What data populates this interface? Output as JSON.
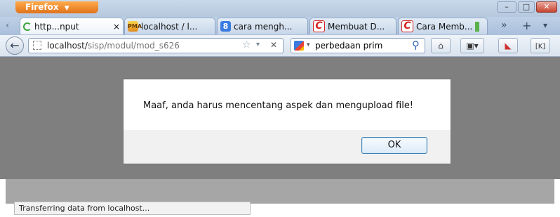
{
  "window": {
    "app_button": "Firefox",
    "controls": {
      "minimize": "–",
      "maximize": "□",
      "close": "✕"
    }
  },
  "tabs": [
    {
      "label": "http...nput",
      "icon": "loading-icon",
      "active": true,
      "close": "×"
    },
    {
      "label": "localhost / l...",
      "icon": "phpmyadmin-icon"
    },
    {
      "label": "cara mengh...",
      "icon": "google-icon"
    },
    {
      "label": "Membuat D...",
      "icon": "opera-c-icon"
    },
    {
      "label": "Cara Memb...",
      "icon": "opera-c-icon"
    }
  ],
  "tabbar_controls": {
    "overflow": "»",
    "new_tab": "+",
    "list": "▾"
  },
  "nav": {
    "back": "←",
    "url_gray_prefix": "localhost/",
    "url_path": "sisp/modul/mod_s626",
    "url_star": "☆",
    "url_drop": "▾",
    "url_stop": "✕",
    "search_text": "perbedaan prim",
    "search_drop": "▾",
    "search_glass": "⚲"
  },
  "dialog": {
    "message": "Maaf, anda harus mencentang aspek dan mengupload file!",
    "ok_label": "OK"
  },
  "status_bar": {
    "text": "Transferring data from localhost..."
  },
  "colors": {
    "firefox_orange": "#f0892c",
    "page_dim": "#7f7f7f",
    "ok_border": "#3c7fb1"
  }
}
